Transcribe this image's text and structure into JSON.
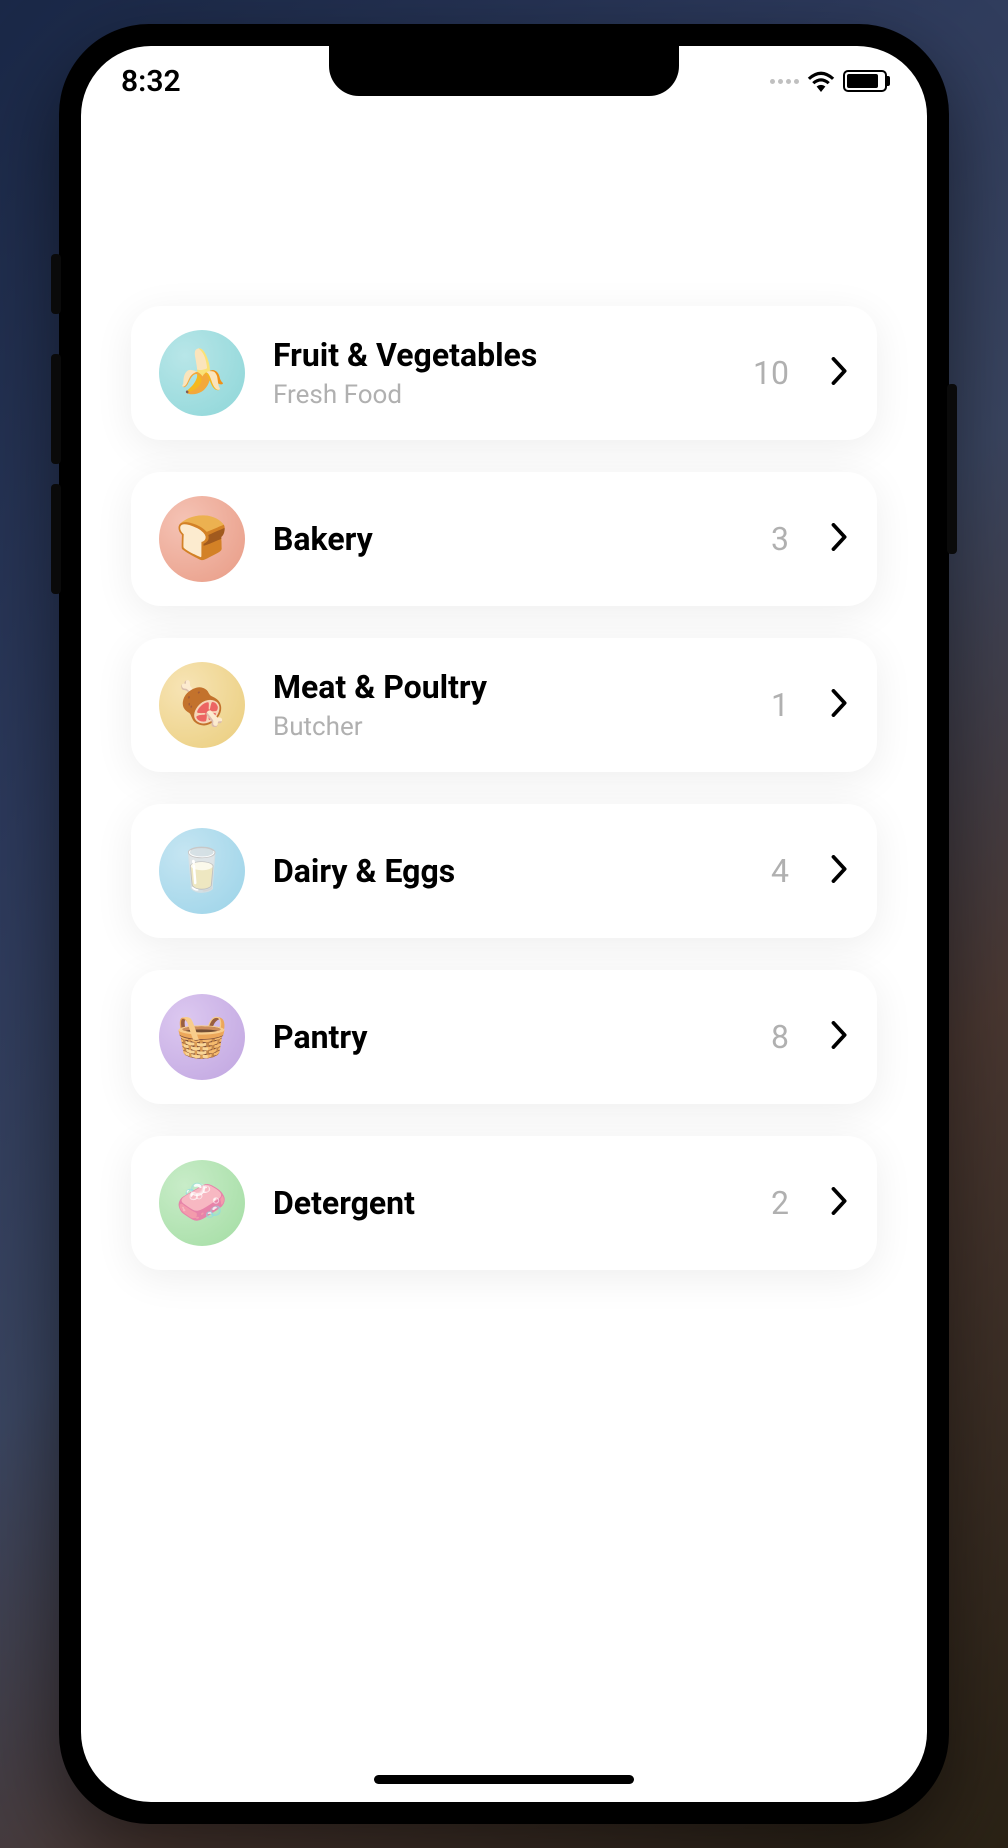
{
  "statusBar": {
    "time": "8:32"
  },
  "categories": [
    {
      "title": "Fruit & Vegetables",
      "subtitle": "Fresh Food",
      "count": "10",
      "iconName": "banana-icon",
      "iconClass": "icon-fruit",
      "emoji": "🍌"
    },
    {
      "title": "Bakery",
      "subtitle": "",
      "count": "3",
      "iconName": "bread-icon",
      "iconClass": "icon-bakery",
      "emoji": "🍞"
    },
    {
      "title": "Meat & Poultry",
      "subtitle": "Butcher",
      "count": "1",
      "iconName": "meat-icon",
      "iconClass": "icon-meat",
      "emoji": "🍖"
    },
    {
      "title": "Dairy & Eggs",
      "subtitle": "",
      "count": "4",
      "iconName": "dairy-icon",
      "iconClass": "icon-dairy",
      "emoji": "🥛"
    },
    {
      "title": "Pantry",
      "subtitle": "",
      "count": "8",
      "iconName": "basket-icon",
      "iconClass": "icon-pantry",
      "emoji": "🧺"
    },
    {
      "title": "Detergent",
      "subtitle": "",
      "count": "2",
      "iconName": "cleaning-icon",
      "iconClass": "icon-detergent",
      "emoji": "🧼"
    }
  ]
}
